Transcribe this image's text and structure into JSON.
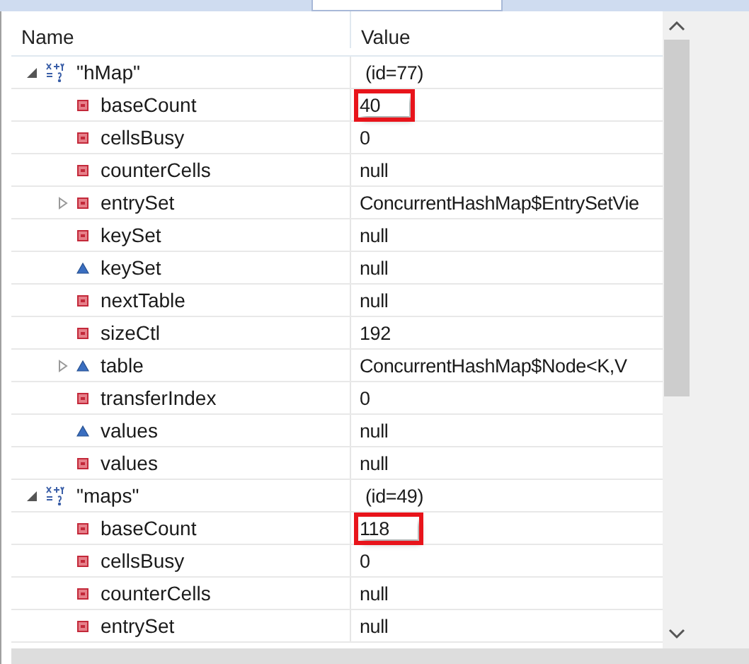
{
  "table": {
    "columns": [
      "Name",
      "Value"
    ],
    "rows": [
      {
        "kind": "expression",
        "name": "\"hMap\"",
        "value": "(id=77)",
        "expanded": true,
        "children": [
          {
            "kind": "private-field",
            "name": "baseCount",
            "value": "40",
            "highlighted": true
          },
          {
            "kind": "private-field",
            "name": "cellsBusy",
            "value": "0",
            "highlighted": false
          },
          {
            "kind": "private-field",
            "name": "counterCells",
            "value": "null",
            "highlighted": false
          },
          {
            "kind": "private-field",
            "name": "entrySet",
            "value": "ConcurrentHashMap$EntrySetVie",
            "highlighted": false,
            "expandable": true
          },
          {
            "kind": "private-field",
            "name": "keySet",
            "value": "null",
            "highlighted": false
          },
          {
            "kind": "default-field",
            "name": "keySet",
            "value": "null",
            "highlighted": false
          },
          {
            "kind": "private-field",
            "name": "nextTable",
            "value": "null",
            "highlighted": false
          },
          {
            "kind": "private-field",
            "name": "sizeCtl",
            "value": "192",
            "highlighted": false
          },
          {
            "kind": "default-field",
            "name": "table",
            "value": "ConcurrentHashMap$Node<K,V",
            "highlighted": false,
            "expandable": true
          },
          {
            "kind": "private-field",
            "name": "transferIndex",
            "value": "0",
            "highlighted": false
          },
          {
            "kind": "default-field",
            "name": "values",
            "value": "null",
            "highlighted": false
          },
          {
            "kind": "private-field",
            "name": "values",
            "value": "null",
            "highlighted": false
          }
        ]
      },
      {
        "kind": "expression",
        "name": "\"maps\"",
        "value": "(id=49)",
        "expanded": true,
        "children": [
          {
            "kind": "private-field",
            "name": "baseCount",
            "value": "118",
            "highlighted": true
          },
          {
            "kind": "private-field",
            "name": "cellsBusy",
            "value": "0",
            "highlighted": false
          },
          {
            "kind": "private-field",
            "name": "counterCells",
            "value": "null",
            "highlighted": false
          },
          {
            "kind": "private-field",
            "name": "entrySet",
            "value": "null",
            "highlighted": false
          }
        ]
      }
    ]
  }
}
